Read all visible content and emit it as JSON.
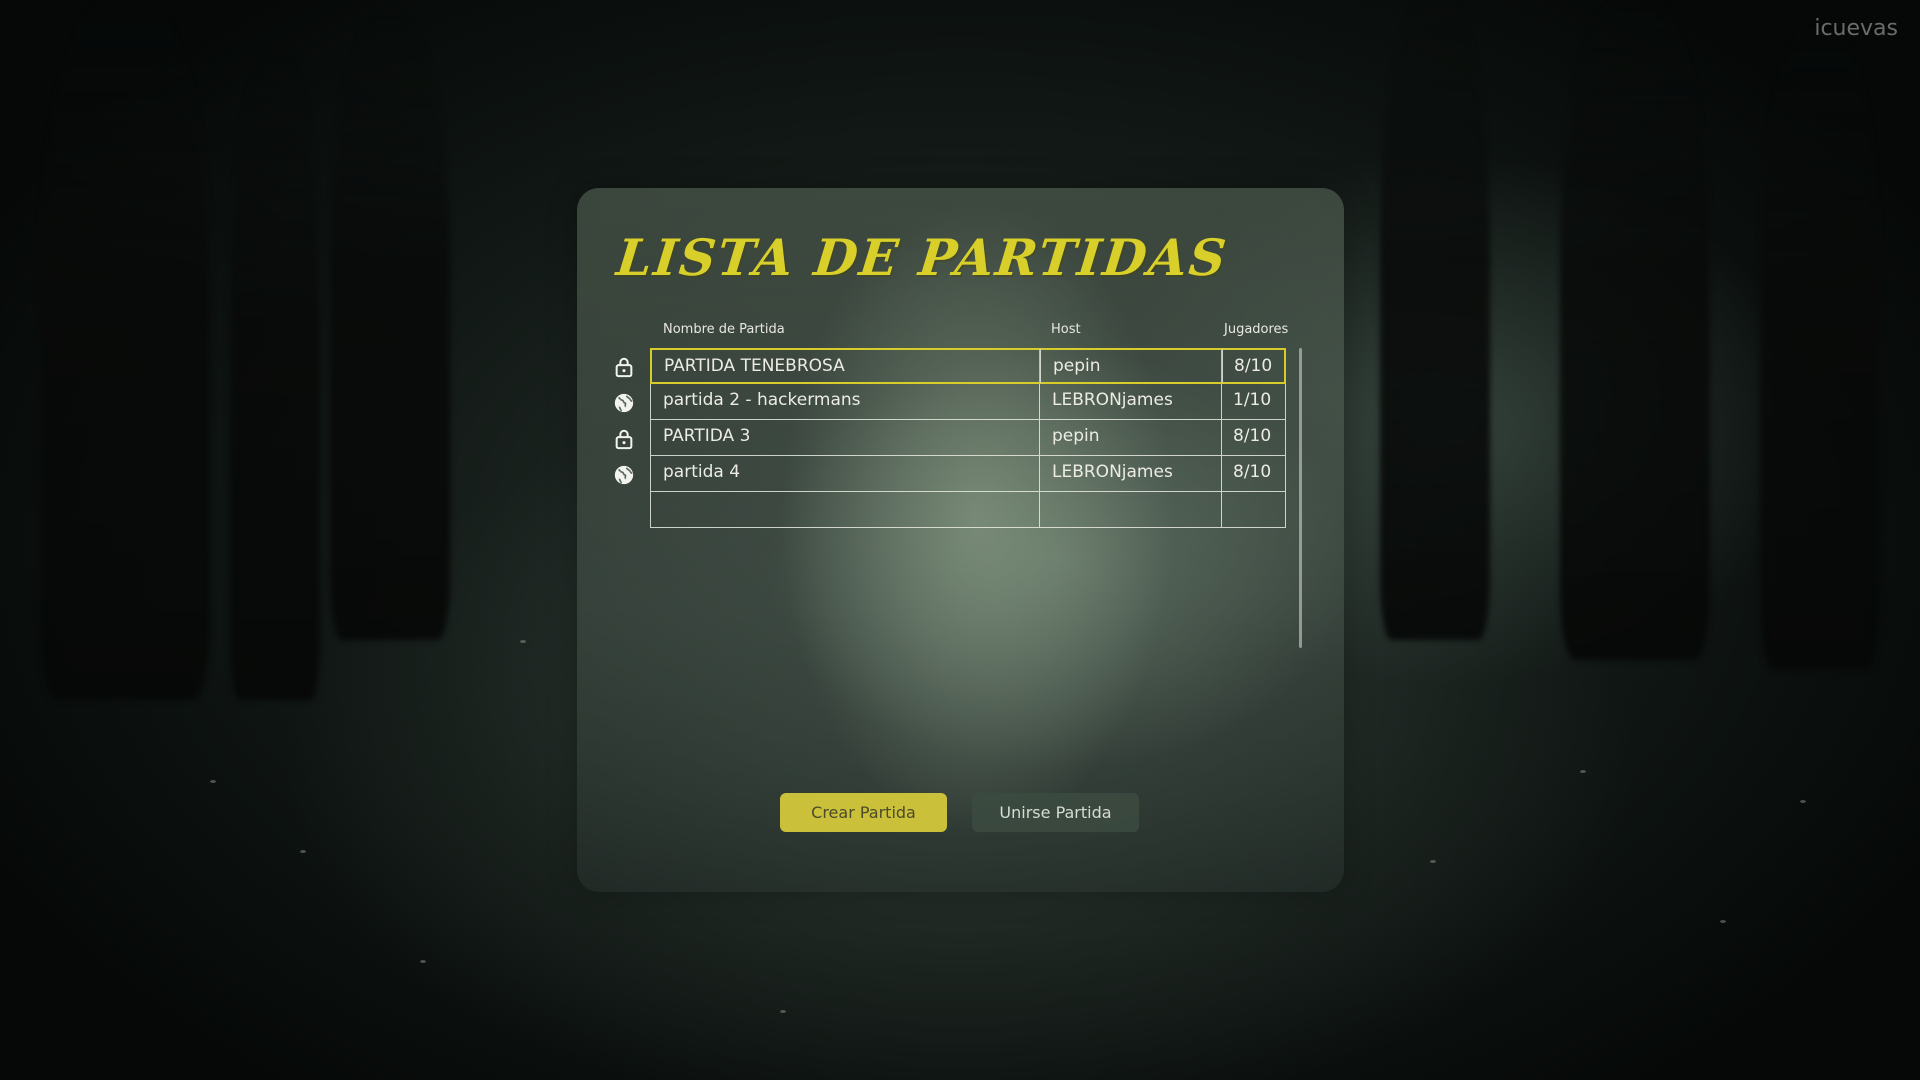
{
  "watermark": "icuevas",
  "title": "LISTA DE PARTIDAS",
  "table": {
    "headers": {
      "name": "Nombre de Partida",
      "host": "Host",
      "players": "Jugadores"
    },
    "rows": [
      {
        "icon": "lock-icon",
        "name": "PARTIDA TENEBROSA",
        "host": "pepin",
        "players": "8/10",
        "selected": true
      },
      {
        "icon": "globe-icon",
        "name": "partida 2 - hackermans",
        "host": "LEBRONjames",
        "players": "1/10",
        "selected": false
      },
      {
        "icon": "lock-icon",
        "name": "PARTIDA 3",
        "host": "pepin",
        "players": "8/10",
        "selected": false
      },
      {
        "icon": "globe-icon",
        "name": "partida 4",
        "host": "LEBRONjames",
        "players": "8/10",
        "selected": false
      },
      {
        "icon": "",
        "name": "",
        "host": "",
        "players": "",
        "selected": false
      }
    ]
  },
  "buttons": {
    "create": "Crear Partida",
    "join": "Unirse Partida"
  },
  "colors": {
    "accent": "#d9cf2a",
    "create_button": "#cbc03a",
    "join_button": "#3c4b41"
  }
}
